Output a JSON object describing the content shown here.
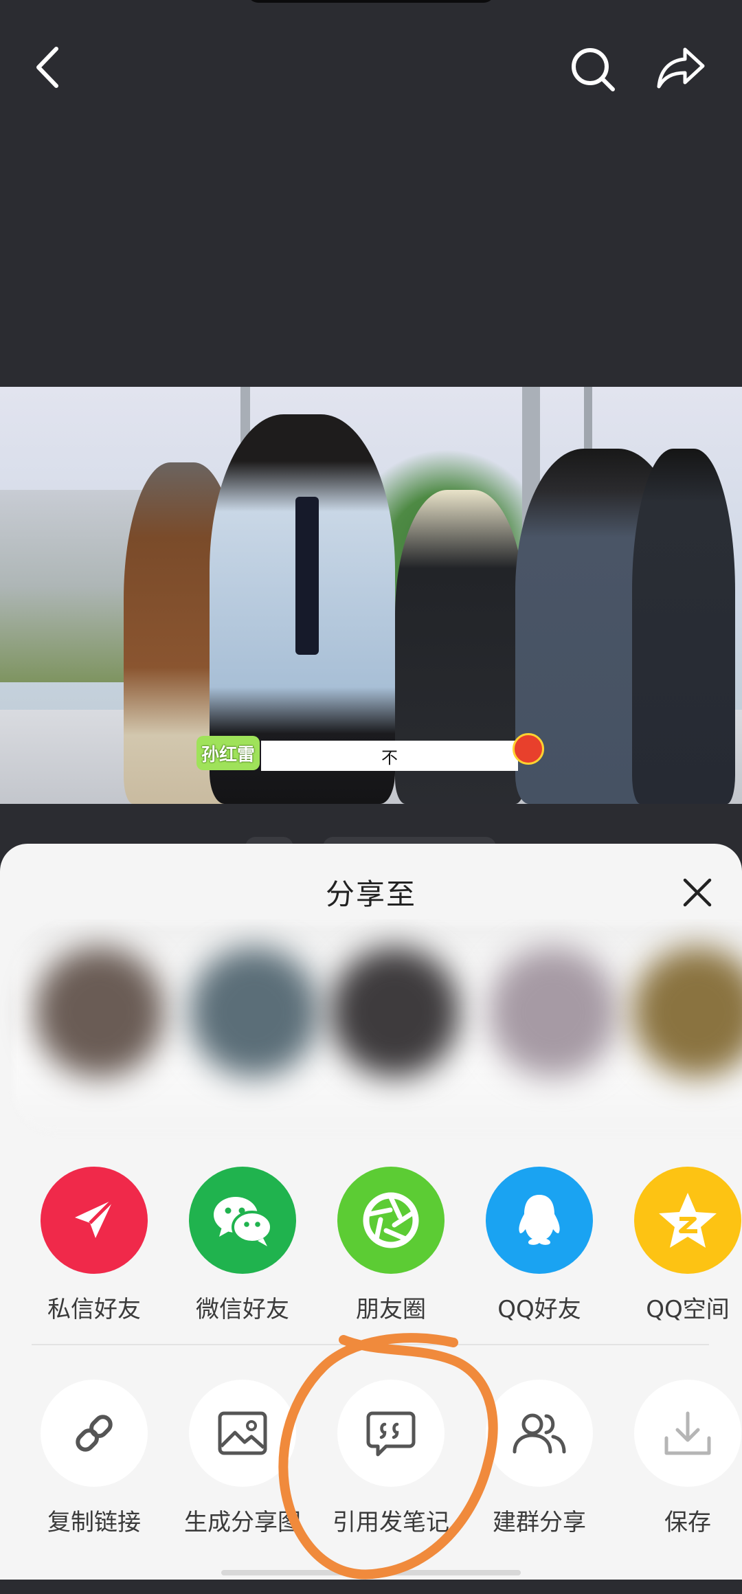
{
  "top_bar": {
    "back_icon": "chevron-left-icon",
    "search_icon": "search-icon",
    "share_icon": "share-arrow-icon"
  },
  "video": {
    "caption_name": "孙红雷",
    "caption_text": "不"
  },
  "share_sheet": {
    "title": "分享至",
    "close_icon": "close-icon",
    "primary_targets": [
      {
        "label": "私信好友",
        "icon": "paper-plane-icon",
        "color": "#f0294a"
      },
      {
        "label": "微信好友",
        "icon": "wechat-icon",
        "color": "#20b34e"
      },
      {
        "label": "朋友圈",
        "icon": "moments-icon",
        "color": "#5ccc34"
      },
      {
        "label": "QQ好友",
        "icon": "qq-penguin-icon",
        "color": "#1aa3f2"
      },
      {
        "label": "QQ空间",
        "icon": "qzone-star-icon",
        "color": "#fdc313"
      }
    ],
    "secondary_actions": [
      {
        "label": "复制链接",
        "icon": "link-icon"
      },
      {
        "label": "生成分享图",
        "icon": "image-icon"
      },
      {
        "label": "引用发笔记",
        "icon": "quote-bubble-icon"
      },
      {
        "label": "建群分享",
        "icon": "group-users-icon"
      },
      {
        "label": "保存",
        "icon": "download-icon"
      }
    ]
  },
  "colors": {
    "annotation": "#f08a3c",
    "background": "#2b2c31",
    "sheet": "#f5f5f5"
  }
}
